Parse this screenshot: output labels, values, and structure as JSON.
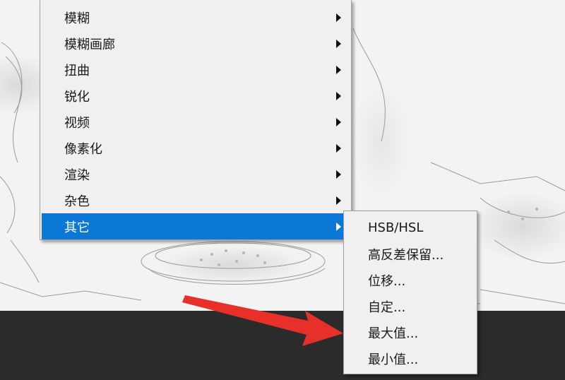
{
  "filter_menu": {
    "items": [
      {
        "label": "模糊",
        "has_submenu": true
      },
      {
        "label": "模糊画廊",
        "has_submenu": true
      },
      {
        "label": "扭曲",
        "has_submenu": true
      },
      {
        "label": "锐化",
        "has_submenu": true
      },
      {
        "label": "视频",
        "has_submenu": true
      },
      {
        "label": "像素化",
        "has_submenu": true
      },
      {
        "label": "渲染",
        "has_submenu": true
      },
      {
        "label": "杂色",
        "has_submenu": true
      },
      {
        "label": "其它",
        "has_submenu": true,
        "active": true
      }
    ]
  },
  "other_submenu": {
    "items": [
      {
        "label": "HSB/HSL"
      },
      {
        "label": "高反差保留..."
      },
      {
        "label": "位移..."
      },
      {
        "label": "自定..."
      },
      {
        "label": "最大值..."
      },
      {
        "label": "最小值..."
      }
    ]
  },
  "colors": {
    "highlight": "#0b78d7",
    "menu_bg": "#f0f0f0",
    "annotation_arrow": "#e8302a",
    "workspace_dark": "#2b2b2b"
  }
}
